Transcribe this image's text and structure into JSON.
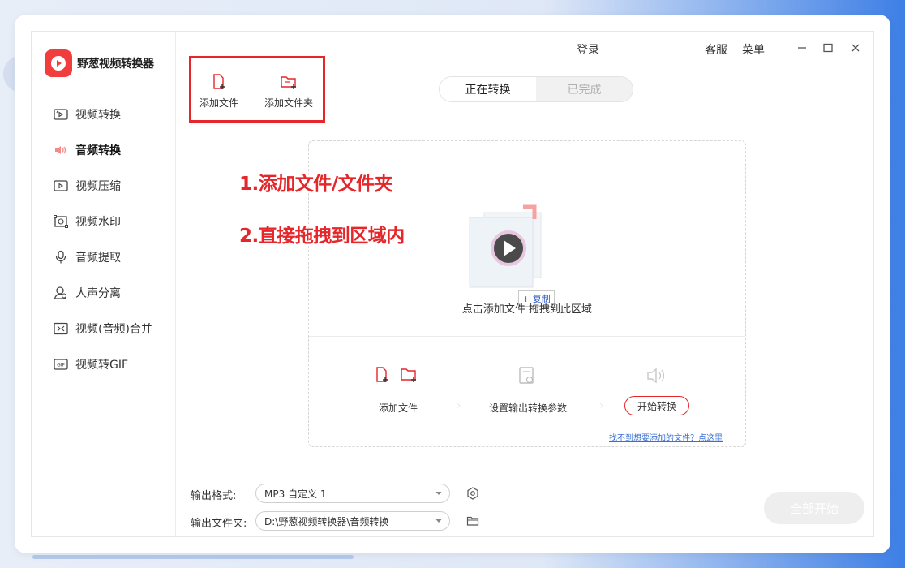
{
  "app": {
    "name": "野葱视频转换器"
  },
  "topbar": {
    "login": "登录",
    "service": "客服",
    "menu": "菜单"
  },
  "sidebar": {
    "items": [
      {
        "label": "视频转换",
        "icon": "video-convert-icon",
        "active": false
      },
      {
        "label": "音频转换",
        "icon": "speaker-icon",
        "active": true
      },
      {
        "label": "视频压缩",
        "icon": "video-compress-icon",
        "active": false
      },
      {
        "label": "视频水印",
        "icon": "watermark-icon",
        "active": false
      },
      {
        "label": "音频提取",
        "icon": "audio-extract-icon",
        "active": false
      },
      {
        "label": "人声分离",
        "icon": "voice-separate-icon",
        "active": false
      },
      {
        "label": "视频(音频)合并",
        "icon": "merge-icon",
        "active": false
      },
      {
        "label": "视频转GIF",
        "icon": "gif-icon",
        "active": false
      }
    ]
  },
  "toolbar": {
    "add_file": "添加文件",
    "add_folder": "添加文件夹"
  },
  "tabs": {
    "converting": "正在转换",
    "completed": "已完成"
  },
  "annotations": {
    "note1": "1.添加文件/文件夹",
    "note2": "2.直接拖拽到区域内"
  },
  "dropzone": {
    "text": "点击添加文件        拖拽到此区域",
    "copy_tag": "+ 复制",
    "step_add": "添加文件",
    "step_settings": "设置输出转换参数",
    "start_button": "开始转换",
    "help_link": "找不到想要添加的文件？点这里"
  },
  "form": {
    "format_label": "输出格式:",
    "format_value": "MP3 自定义 1",
    "folder_label": "输出文件夹:",
    "folder_value": "D:\\野葱视频转换器\\音频转换"
  },
  "actions": {
    "start_all": "全部开始"
  },
  "colors": {
    "accent": "#e5262a",
    "brand": "#f13d3d"
  }
}
